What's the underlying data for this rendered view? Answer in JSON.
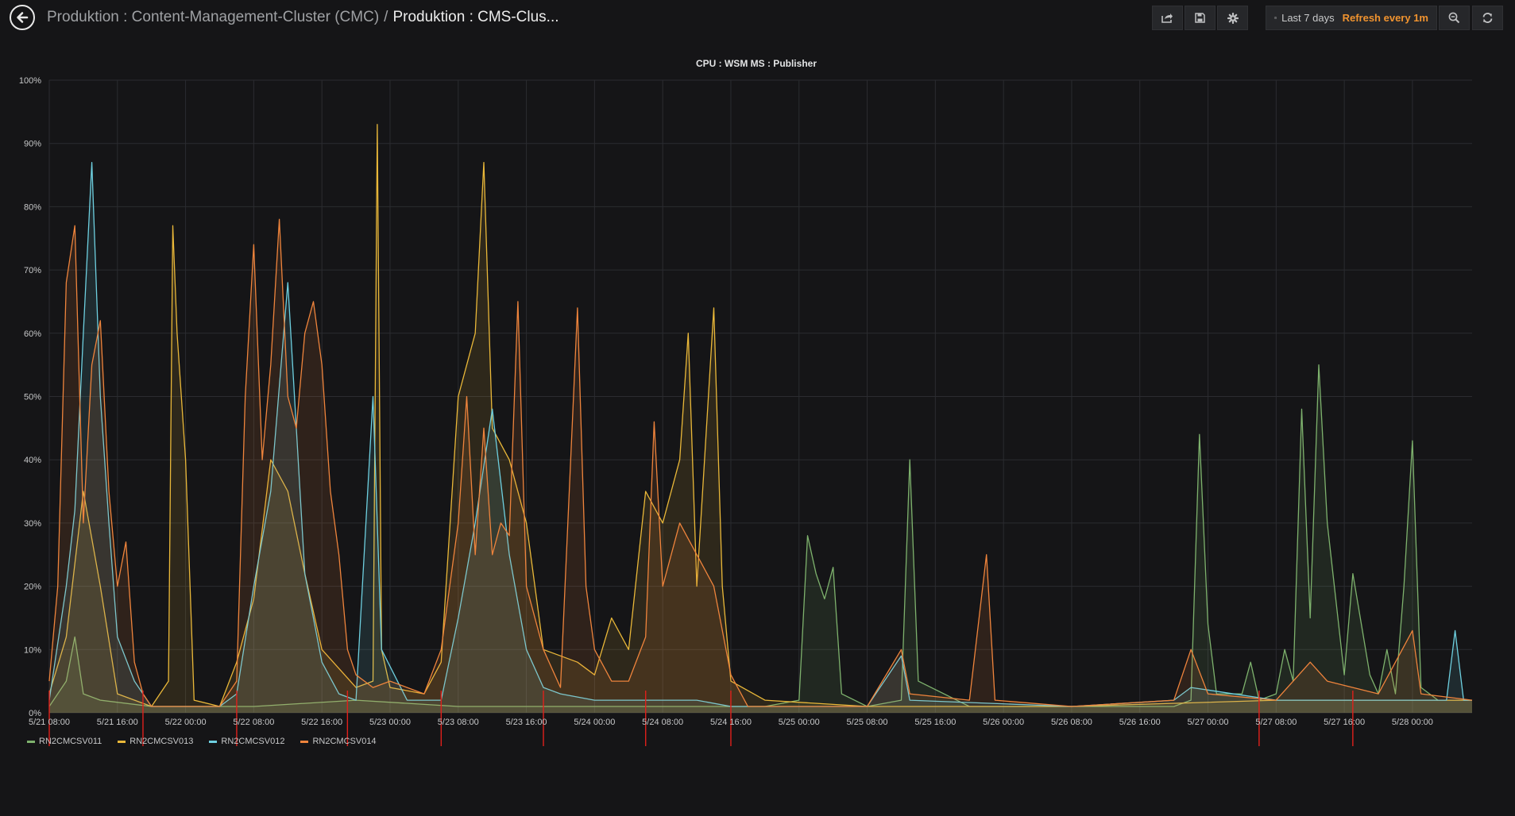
{
  "header": {
    "breadcrumb_parent": "Produktion : Content-Management-Cluster (CMC)",
    "breadcrumb_separator": "/",
    "breadcrumb_current": "Produktion : CMS-Clus...",
    "time_range": "Last 7 days",
    "refresh": "Refresh every 1m"
  },
  "colors": {
    "background": "#151517",
    "grid": "#2b2c30",
    "annotation": "#e0201b",
    "refresh_accent": "#f0932f"
  },
  "chart_data": {
    "type": "line",
    "title": "CPU : WSM MS : Publisher",
    "y_ticks": [
      "0%",
      "10%",
      "20%",
      "30%",
      "40%",
      "50%",
      "60%",
      "70%",
      "80%",
      "90%",
      "100%"
    ],
    "x_ticks": [
      "5/21 08:00",
      "5/21 16:00",
      "5/22 00:00",
      "5/22 08:00",
      "5/22 16:00",
      "5/23 00:00",
      "5/23 08:00",
      "5/23 16:00",
      "5/24 00:00",
      "5/24 08:00",
      "5/24 16:00",
      "5/25 00:00",
      "5/25 08:00",
      "5/25 16:00",
      "5/26 00:00",
      "5/26 08:00",
      "5/26 16:00",
      "5/27 00:00",
      "5/27 08:00",
      "5/27 16:00",
      "5/28 00:00"
    ],
    "ylim": [
      0,
      100
    ],
    "x_range_hours": [
      0,
      167
    ],
    "grid": true,
    "legend_position": "bottom-left",
    "series": [
      {
        "name": "RN2CMCSV011",
        "color": "#7eb26d",
        "points": [
          [
            0,
            1
          ],
          [
            2,
            5
          ],
          [
            3,
            12
          ],
          [
            4,
            3
          ],
          [
            6,
            2
          ],
          [
            12,
            1
          ],
          [
            24,
            1
          ],
          [
            36,
            2
          ],
          [
            48,
            1
          ],
          [
            60,
            1
          ],
          [
            72,
            1
          ],
          [
            84,
            1
          ],
          [
            88,
            2
          ],
          [
            89,
            28
          ],
          [
            90,
            22
          ],
          [
            91,
            18
          ],
          [
            92,
            23
          ],
          [
            93,
            3
          ],
          [
            96,
            1
          ],
          [
            100,
            2
          ],
          [
            101,
            40
          ],
          [
            102,
            5
          ],
          [
            108,
            1
          ],
          [
            120,
            1
          ],
          [
            132,
            1
          ],
          [
            134,
            2
          ],
          [
            135,
            44
          ],
          [
            136,
            14
          ],
          [
            137,
            3
          ],
          [
            140,
            3
          ],
          [
            141,
            8
          ],
          [
            142,
            2
          ],
          [
            144,
            3
          ],
          [
            145,
            10
          ],
          [
            146,
            5
          ],
          [
            147,
            48
          ],
          [
            148,
            15
          ],
          [
            149,
            55
          ],
          [
            150,
            30
          ],
          [
            151,
            18
          ],
          [
            152,
            6
          ],
          [
            153,
            22
          ],
          [
            154,
            14
          ],
          [
            155,
            6
          ],
          [
            156,
            3
          ],
          [
            157,
            10
          ],
          [
            158,
            3
          ],
          [
            159,
            20
          ],
          [
            160,
            43
          ],
          [
            161,
            4
          ],
          [
            163,
            2
          ],
          [
            167,
            2
          ]
        ]
      },
      {
        "name": "RN2CMCSV013",
        "color": "#eab839",
        "points": [
          [
            0,
            3
          ],
          [
            2,
            12
          ],
          [
            4,
            35
          ],
          [
            6,
            20
          ],
          [
            8,
            3
          ],
          [
            12,
            1
          ],
          [
            14,
            5
          ],
          [
            14.5,
            77
          ],
          [
            15,
            60
          ],
          [
            16,
            40
          ],
          [
            17,
            2
          ],
          [
            20,
            1
          ],
          [
            22,
            8
          ],
          [
            24,
            18
          ],
          [
            26,
            40
          ],
          [
            28,
            35
          ],
          [
            30,
            22
          ],
          [
            32,
            10
          ],
          [
            36,
            4
          ],
          [
            38,
            5
          ],
          [
            38.5,
            93
          ],
          [
            39,
            10
          ],
          [
            40,
            4
          ],
          [
            44,
            3
          ],
          [
            46,
            8
          ],
          [
            48,
            50
          ],
          [
            50,
            60
          ],
          [
            51,
            87
          ],
          [
            52,
            45
          ],
          [
            54,
            40
          ],
          [
            56,
            30
          ],
          [
            58,
            10
          ],
          [
            62,
            8
          ],
          [
            64,
            6
          ],
          [
            66,
            15
          ],
          [
            68,
            10
          ],
          [
            70,
            35
          ],
          [
            72,
            30
          ],
          [
            74,
            40
          ],
          [
            75,
            60
          ],
          [
            76,
            20
          ],
          [
            78,
            64
          ],
          [
            79,
            20
          ],
          [
            80,
            5
          ],
          [
            84,
            2
          ],
          [
            96,
            1
          ],
          [
            120,
            1
          ],
          [
            144,
            2
          ],
          [
            167,
            2
          ]
        ]
      },
      {
        "name": "RN2CMCSV012",
        "color": "#6ed0e0",
        "points": [
          [
            0,
            2
          ],
          [
            2,
            20
          ],
          [
            3,
            32
          ],
          [
            4,
            60
          ],
          [
            5,
            87
          ],
          [
            6,
            50
          ],
          [
            7,
            30
          ],
          [
            8,
            12
          ],
          [
            10,
            5
          ],
          [
            12,
            1
          ],
          [
            20,
            1
          ],
          [
            22,
            3
          ],
          [
            24,
            20
          ],
          [
            26,
            35
          ],
          [
            28,
            68
          ],
          [
            30,
            22
          ],
          [
            32,
            8
          ],
          [
            34,
            3
          ],
          [
            36,
            2
          ],
          [
            38,
            50
          ],
          [
            39,
            10
          ],
          [
            42,
            2
          ],
          [
            46,
            2
          ],
          [
            48,
            15
          ],
          [
            50,
            30
          ],
          [
            52,
            48
          ],
          [
            54,
            25
          ],
          [
            56,
            10
          ],
          [
            58,
            4
          ],
          [
            60,
            3
          ],
          [
            64,
            2
          ],
          [
            70,
            2
          ],
          [
            76,
            2
          ],
          [
            80,
            1
          ],
          [
            96,
            1
          ],
          [
            100,
            9
          ],
          [
            101,
            2
          ],
          [
            120,
            1
          ],
          [
            132,
            2
          ],
          [
            134,
            4
          ],
          [
            144,
            2
          ],
          [
            156,
            2
          ],
          [
            164,
            2
          ],
          [
            165,
            13
          ],
          [
            166,
            2
          ],
          [
            167,
            2
          ]
        ]
      },
      {
        "name": "RN2CMCSV014",
        "color": "#ef843c",
        "points": [
          [
            0,
            5
          ],
          [
            1,
            20
          ],
          [
            2,
            68
          ],
          [
            3,
            77
          ],
          [
            4,
            30
          ],
          [
            5,
            55
          ],
          [
            6,
            62
          ],
          [
            7,
            35
          ],
          [
            8,
            20
          ],
          [
            9,
            27
          ],
          [
            10,
            8
          ],
          [
            11,
            3
          ],
          [
            12,
            1
          ],
          [
            20,
            1
          ],
          [
            22,
            5
          ],
          [
            23,
            50
          ],
          [
            24,
            74
          ],
          [
            25,
            40
          ],
          [
            26,
            55
          ],
          [
            27,
            78
          ],
          [
            28,
            50
          ],
          [
            29,
            45
          ],
          [
            30,
            60
          ],
          [
            31,
            65
          ],
          [
            32,
            55
          ],
          [
            33,
            35
          ],
          [
            34,
            25
          ],
          [
            35,
            10
          ],
          [
            36,
            6
          ],
          [
            38,
            4
          ],
          [
            40,
            5
          ],
          [
            42,
            4
          ],
          [
            44,
            3
          ],
          [
            46,
            10
          ],
          [
            48,
            30
          ],
          [
            49,
            50
          ],
          [
            50,
            25
          ],
          [
            51,
            45
          ],
          [
            52,
            25
          ],
          [
            53,
            30
          ],
          [
            54,
            28
          ],
          [
            55,
            65
          ],
          [
            56,
            20
          ],
          [
            58,
            10
          ],
          [
            60,
            4
          ],
          [
            62,
            64
          ],
          [
            63,
            20
          ],
          [
            64,
            10
          ],
          [
            66,
            5
          ],
          [
            68,
            5
          ],
          [
            70,
            12
          ],
          [
            71,
            46
          ],
          [
            72,
            20
          ],
          [
            74,
            30
          ],
          [
            76,
            25
          ],
          [
            78,
            20
          ],
          [
            80,
            6
          ],
          [
            82,
            1
          ],
          [
            96,
            1
          ],
          [
            100,
            10
          ],
          [
            101,
            3
          ],
          [
            108,
            2
          ],
          [
            110,
            25
          ],
          [
            111,
            2
          ],
          [
            120,
            1
          ],
          [
            132,
            2
          ],
          [
            134,
            10
          ],
          [
            136,
            3
          ],
          [
            144,
            2
          ],
          [
            148,
            8
          ],
          [
            150,
            5
          ],
          [
            156,
            3
          ],
          [
            160,
            13
          ],
          [
            161,
            3
          ],
          [
            167,
            2
          ]
        ]
      }
    ],
    "annotations_hours": [
      0,
      11,
      22,
      35,
      46,
      58,
      70,
      80,
      142,
      153
    ]
  }
}
